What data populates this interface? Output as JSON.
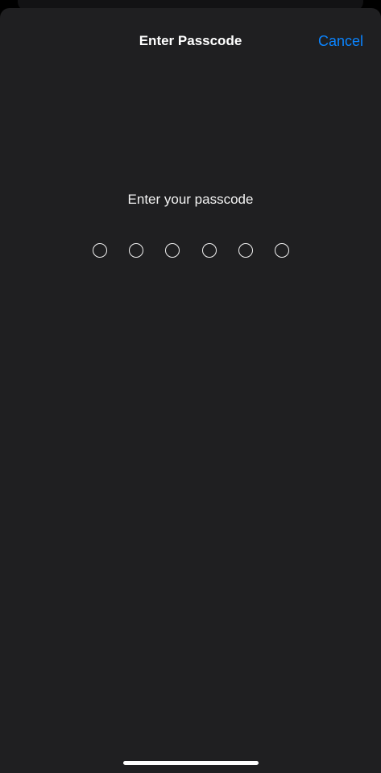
{
  "header": {
    "title": "Enter Passcode",
    "cancel_label": "Cancel"
  },
  "passcode": {
    "prompt": "Enter your passcode",
    "length": 6,
    "entered": 0
  },
  "colors": {
    "accent": "#0a84ff",
    "sheet_background": "#1f1f21",
    "text": "#ffffff"
  }
}
